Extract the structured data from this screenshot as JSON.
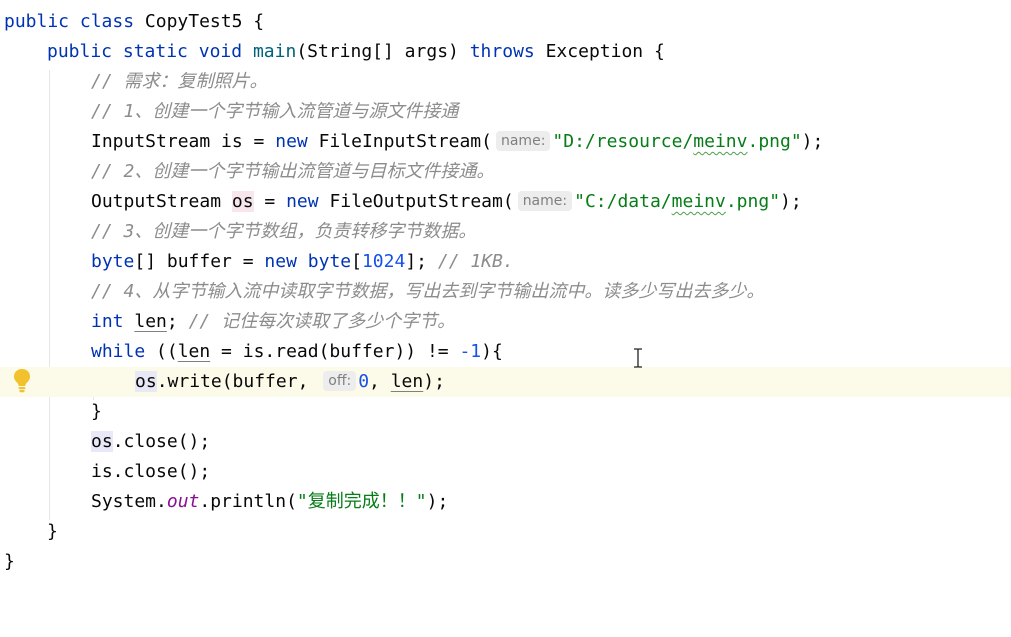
{
  "editor": {
    "line1": {
      "kw_public": "public",
      "kw_class": "class",
      "class_name": "CopyTest5",
      "brace": "{"
    },
    "line2": {
      "kw_public": "public",
      "kw_static": "static",
      "kw_void": "void",
      "method": "main",
      "params": "(String[] args)",
      "kw_throws": "throws",
      "exception": "Exception {"
    },
    "line3": {
      "comment": "// 需求：复制照片。"
    },
    "line4": {
      "comment": "// 1、创建一个字节输入流管道与源文件接通"
    },
    "line5": {
      "decl": "InputStream is = ",
      "kw_new": "new",
      "ctor": "FileInputStream(",
      "hint": "name:",
      "str": "\"D:/resource/meinv.png\"",
      "end": ");"
    },
    "line6": {
      "comment": "// 2、创建一个字节输出流管道与目标文件接通。"
    },
    "line7": {
      "type": "OutputStream ",
      "var": "os",
      "assign": " = ",
      "kw_new": "new",
      "ctor": "FileOutputStream(",
      "hint": "name:",
      "str": "\"C:/data/meinv.png\"",
      "end": ");"
    },
    "line8": {
      "comment": "// 3、创建一个字节数组，负责转移字节数据。"
    },
    "line9": {
      "kw_byte": "byte",
      "decl": "[] buffer = ",
      "kw_new": "new",
      "kw_byte2": "byte",
      "bracket_open": "[",
      "num": "1024",
      "bracket_close": "];",
      "comment": "// 1KB."
    },
    "line10": {
      "comment": "// 4、从字节输入流中读取字节数据，写出去到字节输出流中。读多少写出去多少。"
    },
    "line11": {
      "kw_int": "int",
      "var": "len",
      "semi": ";",
      "comment": "// 记住每次读取了多少个字节。"
    },
    "line12": {
      "kw_while": "while",
      "open": " ((",
      "var": "len",
      "rest": " = is.read(buffer)) != ",
      "num": "-1",
      "close": "){"
    },
    "line13": {
      "obj": "os",
      "call": ".write(buffer, ",
      "hint": "off:",
      "num": "0",
      "comma": ", ",
      "var": "len",
      "end": ");"
    },
    "line14": {
      "brace": "}"
    },
    "line15": {
      "obj": "os",
      "call": ".close();"
    },
    "line16": {
      "call": "is.close();"
    },
    "line17": {
      "pre": "System.",
      "field": "out",
      "mid": ".println(",
      "str": "\"复制完成！！\"",
      "end": ");"
    },
    "line18": {
      "brace": "}"
    },
    "line19": {
      "brace": "}"
    }
  }
}
